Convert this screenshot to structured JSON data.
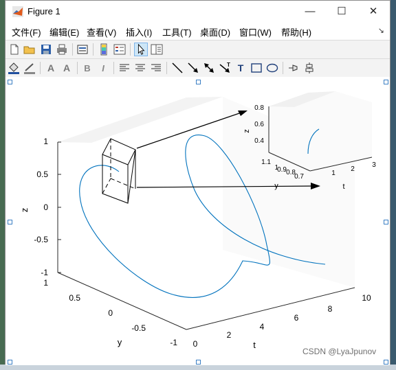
{
  "window": {
    "title": "Figure 1",
    "minimize": "—",
    "maximize": "☐",
    "close": "✕"
  },
  "menu": {
    "items": [
      "文件(F)",
      "编辑(E)",
      "查看(V)",
      "插入(I)",
      "工具(T)",
      "桌面(D)",
      "窗口(W)",
      "帮助(H)"
    ],
    "overflow": "↘"
  },
  "toolbar1": {
    "icons": [
      "new-figure-icon",
      "open-file-icon",
      "save-icon",
      "print-icon",
      "print-preview-icon",
      "colorbar-icon",
      "legend-icon",
      "edit-plot-icon",
      "property-editor-icon"
    ]
  },
  "toolbar2": {
    "icons": [
      "fill-color-icon",
      "line-color-icon",
      "text-color-icon",
      "font-icon",
      "bold-icon",
      "italic-icon",
      "align-left-icon",
      "align-center-icon",
      "align-right-icon",
      "line-icon",
      "arrow-icon",
      "double-arrow-icon",
      "text-arrow-icon",
      "textbox-icon",
      "rectangle-icon",
      "ellipse-icon",
      "pin-icon",
      "align-distribute-icon"
    ]
  },
  "main_plot": {
    "zticks": [
      "1",
      "0.5",
      "0",
      "-0.5",
      "-1"
    ],
    "yticks": [
      "1",
      "0.5",
      "0",
      "-0.5",
      "-1"
    ],
    "xticks": [
      "0",
      "2",
      "4",
      "6",
      "8",
      "10"
    ],
    "xlabel": "t",
    "ylabel": "y",
    "zlabel": "z"
  },
  "inset_plot": {
    "zticks": [
      "0.8",
      "0.6",
      "0.4"
    ],
    "yticks": [
      "1.1",
      "1",
      "0.9",
      "0.8",
      "0.7"
    ],
    "xticks": [
      "1",
      "2",
      "3"
    ],
    "xlabel": "t",
    "ylabel": "y",
    "zlabel": "z"
  },
  "watermark": "CSDN @LyaJpunov",
  "colors": {
    "curve": "#0072bd",
    "selection_handle": "#3b7fc4"
  }
}
